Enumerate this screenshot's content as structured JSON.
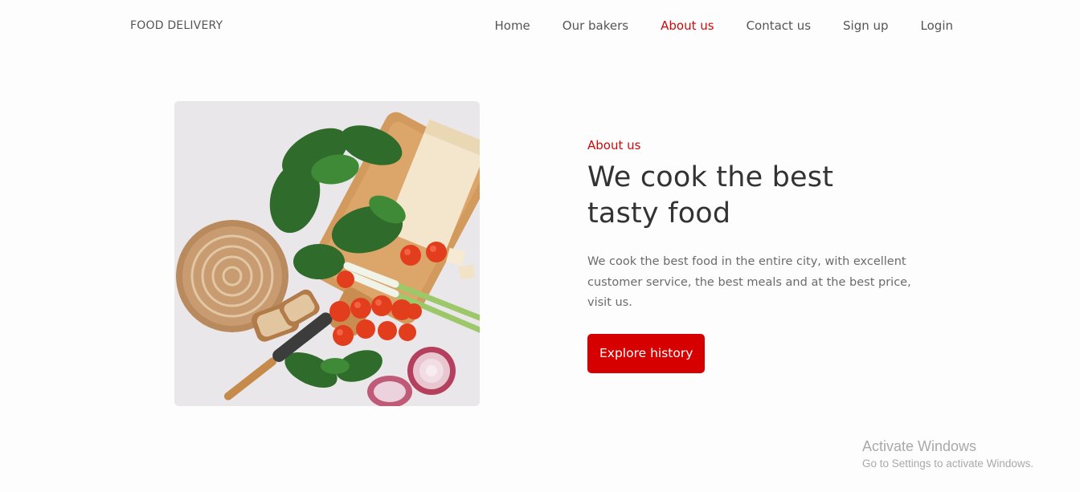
{
  "brand": "FOOD DELIVERY",
  "nav": {
    "items": [
      "Home",
      "Our bakers",
      "About us",
      "Contact us",
      "Sign up",
      "Login"
    ],
    "active": "About us"
  },
  "about": {
    "eyebrow": "About us",
    "headline_line1": "We cook the best",
    "headline_line2": "tasty food",
    "description": "We cook the best food in the entire city, with excellent customer service, the best meals and at the best price, visit us.",
    "button_label": "Explore history"
  },
  "watermark": {
    "title": "Activate Windows",
    "subtitle": "Go to Settings to activate Windows."
  },
  "colors": {
    "accent": "#cc0a0a",
    "button": "#d60000",
    "text_dark": "#333333",
    "text_muted": "#6b6b6b"
  },
  "icons": {
    "hero_image": "food-ingredients-photo"
  }
}
